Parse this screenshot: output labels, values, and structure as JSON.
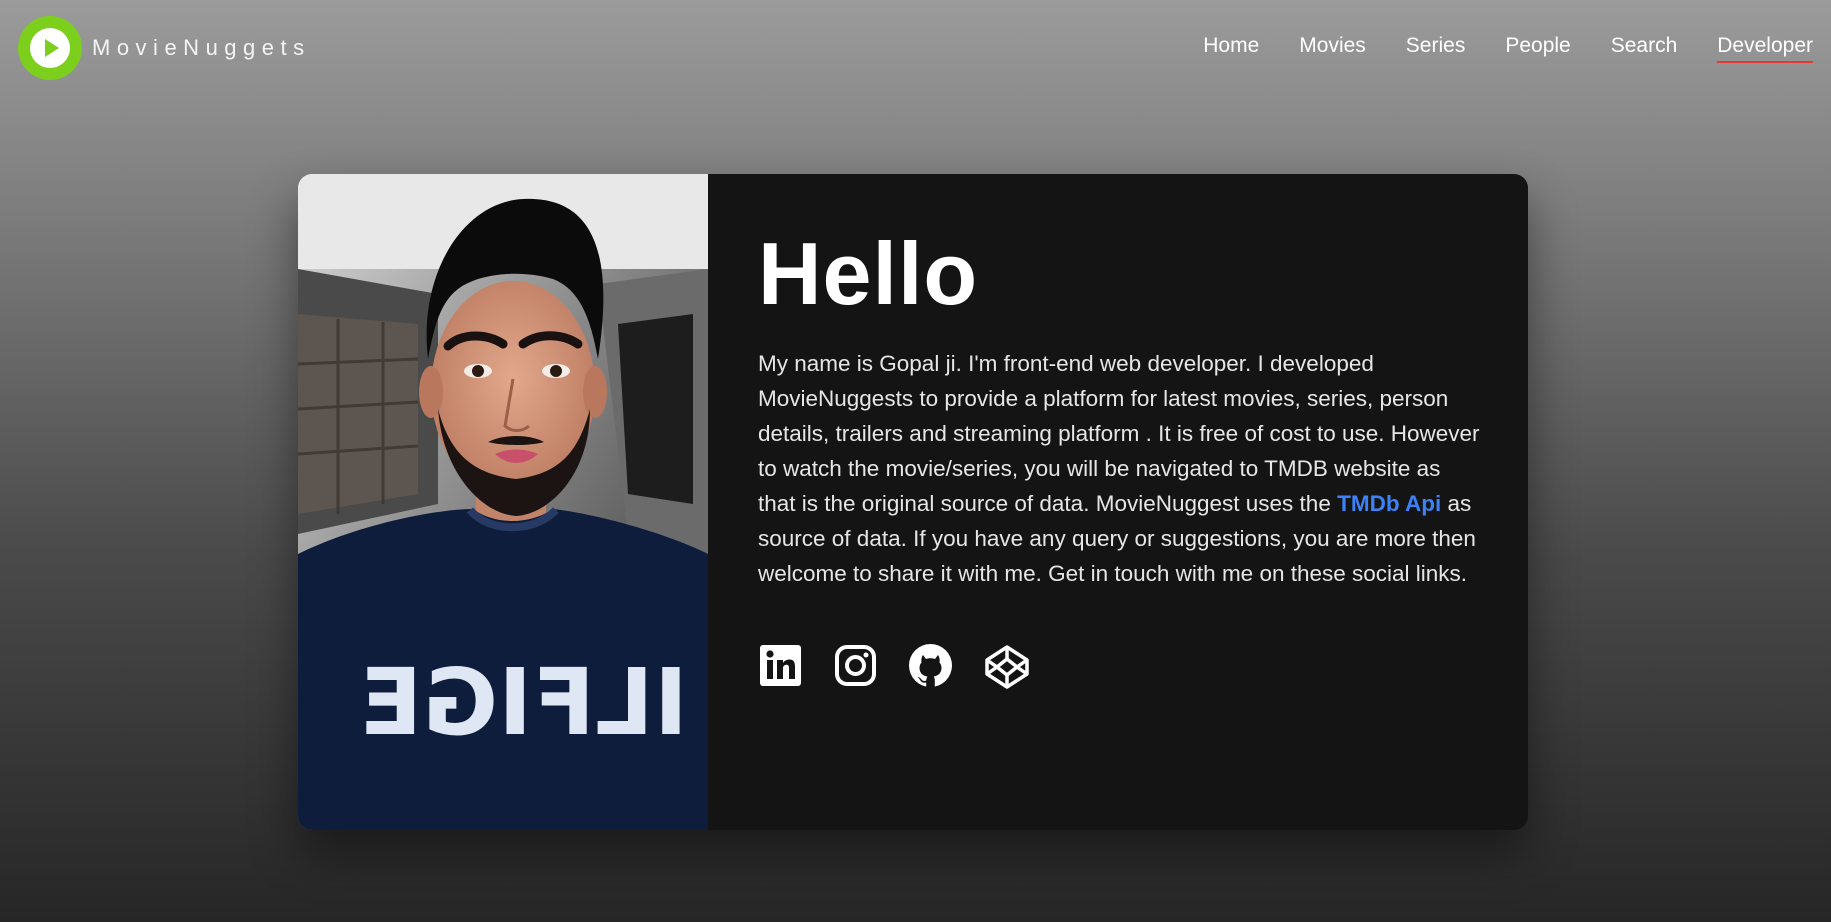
{
  "brand": {
    "name": "MovieNuggets"
  },
  "nav": {
    "items": [
      {
        "label": "Home"
      },
      {
        "label": "Movies"
      },
      {
        "label": "Series"
      },
      {
        "label": "People"
      },
      {
        "label": "Search"
      },
      {
        "label": "Developer"
      }
    ],
    "active": "Developer"
  },
  "profile": {
    "heading": "Hello",
    "bio_before_link": "My name is Gopal ji. I'm front-end web developer. I developed MovieNuggests to provide a platform for latest movies, series, person details, trailers and streaming platform . It is free of cost to use. However to watch the movie/series, you will be navigated to TMDB website as that is the original source of data. MovieNuggest uses the ",
    "link_label": "TMDb Api",
    "bio_after_link": " as source of data. If you have any query or suggestions, you are more then welcome to share it with me. Get in touch with me on these social links.",
    "photo_shirt_text": "ILFIGE"
  },
  "socials": [
    {
      "icon": "linkedin-icon"
    },
    {
      "icon": "instagram-icon"
    },
    {
      "icon": "github-icon"
    },
    {
      "icon": "codepen-icon"
    }
  ],
  "colors": {
    "logo_green": "#7ccf1d",
    "active_underline": "#e53935",
    "link_blue": "#3b82f6",
    "card_bg": "#141414"
  }
}
